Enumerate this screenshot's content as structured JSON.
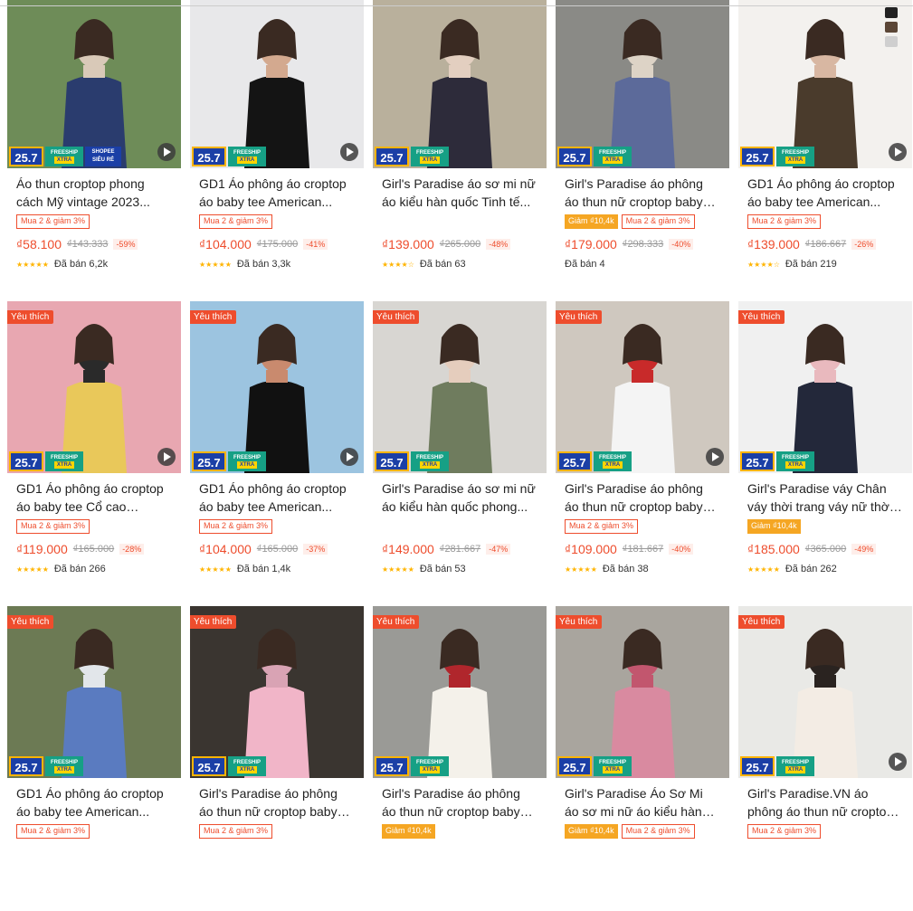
{
  "labels": {
    "favorite": "Yêu thích",
    "promo_number": "25.7",
    "freeship_top": "FREESHIP",
    "freeship_bottom": "XTRA",
    "mall_top": "SHOPEE",
    "mall_bottom": "SIÊU RẺ"
  },
  "colors": {
    "accent": "#ee4d2d",
    "badge_blue": "#1b3fa6",
    "freeship_green": "#16a085",
    "star": "#ffb400"
  },
  "products": [
    {
      "title": "Áo thun croptop phong cách Mỹ vintage 2023...",
      "tags": [
        {
          "text": "Mua 2 & giảm 3%",
          "style": "red"
        }
      ],
      "price": "₫58.100",
      "old_price": "₫143.333",
      "discount": "-59%",
      "stars": "★★★★★",
      "sold": "Đã bán 6,2k",
      "fav": false,
      "mall": true,
      "video": true,
      "palette": [
        "#6e8c58",
        "#2a3c6e",
        "#d9c9b8"
      ]
    },
    {
      "title": "GD1 Áo phông áo croptop áo baby tee American...",
      "tags": [
        {
          "text": "Mua 2 & giảm 3%",
          "style": "red"
        }
      ],
      "price": "₫104.000",
      "old_price": "₫175.000",
      "discount": "-41%",
      "stars": "★★★★★",
      "sold": "Đã bán 3,3k",
      "fav": false,
      "mall": false,
      "video": true,
      "palette": [
        "#e8e8ea",
        "#141414",
        "#d3a98f"
      ]
    },
    {
      "title": "Girl's Paradise áo sơ mi nữ áo kiểu hàn quốc Tinh tế...",
      "tags": [],
      "price": "₫139.000",
      "old_price": "₫265.000",
      "discount": "-48%",
      "stars": "★★★★☆",
      "sold": "Đã bán 63",
      "fav": false,
      "mall": false,
      "video": false,
      "palette": [
        "#b9b09c",
        "#2d2b3a",
        "#e3cfc0"
      ]
    },
    {
      "title": "Girl's Paradise áo phông áo thun nữ croptop baby tee...",
      "tags": [
        {
          "text": "Giảm ₫10,4k",
          "style": "org"
        },
        {
          "text": "Mua 2 & giảm 3%",
          "style": "red"
        }
      ],
      "price": "₫179.000",
      "old_price": "₫298.333",
      "discount": "-40%",
      "stars": "",
      "sold": "Đã bán 4",
      "fav": false,
      "mall": false,
      "video": false,
      "palette": [
        "#8a8a86",
        "#5c6a9a",
        "#ddd3c6"
      ]
    },
    {
      "title": "GD1 Áo phông áo croptop áo baby tee American...",
      "tags": [
        {
          "text": "Mua 2 & giảm 3%",
          "style": "red"
        }
      ],
      "price": "₫139.000",
      "old_price": "₫186.667",
      "discount": "-26%",
      "stars": "★★★★☆",
      "sold": "Đã bán 219",
      "fav": false,
      "mall": false,
      "video": true,
      "palette": [
        "#f3f1ee",
        "#4a3b2c",
        "#d8b7a2"
      ],
      "swatches": [
        "#222222",
        "#5b4636",
        "#cfcfcf"
      ]
    },
    {
      "title": "GD1 Áo phông áo croptop áo baby tee Cổ cao Thanh...",
      "tags": [
        {
          "text": "Mua 2 & giảm 3%",
          "style": "red"
        }
      ],
      "price": "₫119.000",
      "old_price": "₫165.000",
      "discount": "-28%",
      "stars": "★★★★★",
      "sold": "Đã bán 266",
      "fav": true,
      "mall": false,
      "video": true,
      "palette": [
        "#e8a7b1",
        "#e9c85a",
        "#2a2a2a"
      ]
    },
    {
      "title": "GD1 Áo phông áo croptop áo baby tee American...",
      "tags": [
        {
          "text": "Mua 2 & giảm 3%",
          "style": "red"
        }
      ],
      "price": "₫104.000",
      "old_price": "₫165.000",
      "discount": "-37%",
      "stars": "★★★★★",
      "sold": "Đã bán 1,4k",
      "fav": true,
      "mall": false,
      "video": true,
      "palette": [
        "#9cc4e0",
        "#111111",
        "#c98a6e"
      ]
    },
    {
      "title": "Girl's Paradise áo sơ mi nữ áo kiểu hàn quốc phong...",
      "tags": [],
      "price": "₫149.000",
      "old_price": "₫281.667",
      "discount": "-47%",
      "stars": "★★★★★",
      "sold": "Đã bán 53",
      "fav": true,
      "mall": false,
      "video": false,
      "palette": [
        "#d8d6d2",
        "#6f7c5e",
        "#e5cdbd"
      ]
    },
    {
      "title": "Girl's Paradise áo phông áo thun nữ croptop baby tee...",
      "tags": [
        {
          "text": "Mua 2 & giảm 3%",
          "style": "red"
        }
      ],
      "price": "₫109.000",
      "old_price": "₫181.667",
      "discount": "-40%",
      "stars": "★★★★★",
      "sold": "Đã bán 38",
      "fav": true,
      "mall": false,
      "video": true,
      "palette": [
        "#cfc8bf",
        "#f4f4f4",
        "#c82a2a"
      ]
    },
    {
      "title": "Girl's Paradise váy Chân váy thời trang váy nữ thời tran...",
      "tags": [
        {
          "text": "Giảm ₫10,4k",
          "style": "org"
        }
      ],
      "price": "₫185.000",
      "old_price": "₫365.000",
      "discount": "-49%",
      "stars": "★★★★★",
      "sold": "Đã bán 262",
      "fav": true,
      "mall": false,
      "video": false,
      "palette": [
        "#f0f0f0",
        "#23283a",
        "#e9b9be"
      ]
    },
    {
      "title": "GD1 Áo phông áo croptop áo baby tee American...",
      "tags": [
        {
          "text": "Mua 2 & giảm 3%",
          "style": "red"
        }
      ],
      "price": "",
      "old_price": "",
      "discount": "",
      "stars": "",
      "sold": "",
      "fav": true,
      "mall": false,
      "video": false,
      "palette": [
        "#6c7a54",
        "#5a7bc0",
        "#e2e6ea"
      ]
    },
    {
      "title": "Girl's Paradise áo phông áo thun nữ croptop baby tee...",
      "tags": [
        {
          "text": "Mua 2 & giảm 3%",
          "style": "red"
        }
      ],
      "price": "",
      "old_price": "",
      "discount": "",
      "stars": "",
      "sold": "",
      "fav": true,
      "mall": false,
      "video": false,
      "palette": [
        "#3a3530",
        "#f1b5c8",
        "#d9a3b4"
      ]
    },
    {
      "title": "Girl's Paradise áo phông áo thun nữ croptop baby tee...",
      "tags": [
        {
          "text": "Giảm ₫10,4k",
          "style": "org"
        }
      ],
      "price": "",
      "old_price": "",
      "discount": "",
      "stars": "",
      "sold": "",
      "fav": true,
      "mall": false,
      "video": false,
      "palette": [
        "#9a9a96",
        "#f4f1ea",
        "#b0262c"
      ]
    },
    {
      "title": "Girl's Paradise Áo Sơ Mi áo sơ mi nữ áo kiểu hàn quốc...",
      "tags": [
        {
          "text": "Giảm ₫10,4k",
          "style": "org"
        },
        {
          "text": "Mua 2 & giảm 3%",
          "style": "red"
        }
      ],
      "price": "",
      "old_price": "",
      "discount": "",
      "stars": "",
      "sold": "",
      "fav": true,
      "mall": false,
      "video": false,
      "palette": [
        "#a9a59e",
        "#d98aa0",
        "#c2566e"
      ]
    },
    {
      "title": "Girl's Paradise.VN áo phông áo thun nữ croptop baby...",
      "tags": [
        {
          "text": "Mua 2 & giảm 3%",
          "style": "red"
        }
      ],
      "price": "",
      "old_price": "",
      "discount": "",
      "stars": "",
      "sold": "",
      "fav": true,
      "mall": false,
      "video": true,
      "palette": [
        "#e9e9e6",
        "#f3ece4",
        "#2a2320"
      ]
    }
  ]
}
